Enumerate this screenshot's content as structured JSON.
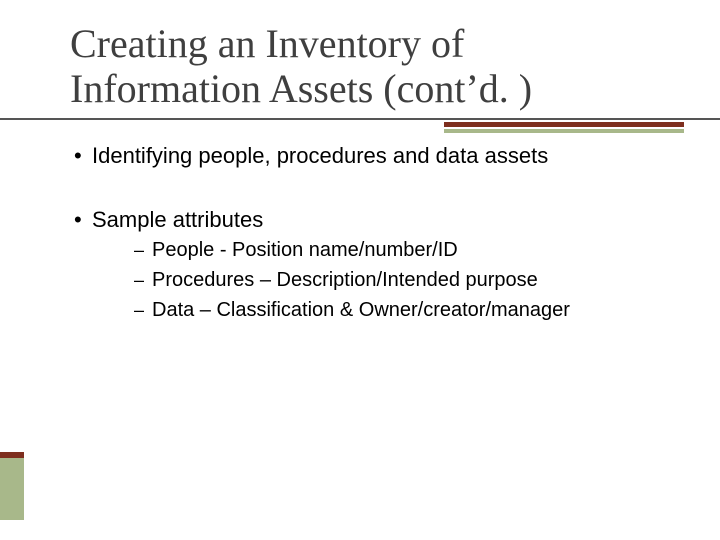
{
  "title": "Creating an Inventory of Information Assets (cont’d. )",
  "bullets": [
    {
      "text": "Identifying people, procedures and data assets",
      "sub": []
    },
    {
      "text": "Sample attributes",
      "sub": [
        "People - Position name/number/ID",
        "Procedures – Description/Intended purpose",
        "Data – Classification & Owner/creator/manager"
      ]
    }
  ],
  "colors": {
    "accent_dark": "#7e2e1e",
    "accent_light": "#a8b88a",
    "rule": "#555555",
    "title": "#3f3f3f"
  }
}
